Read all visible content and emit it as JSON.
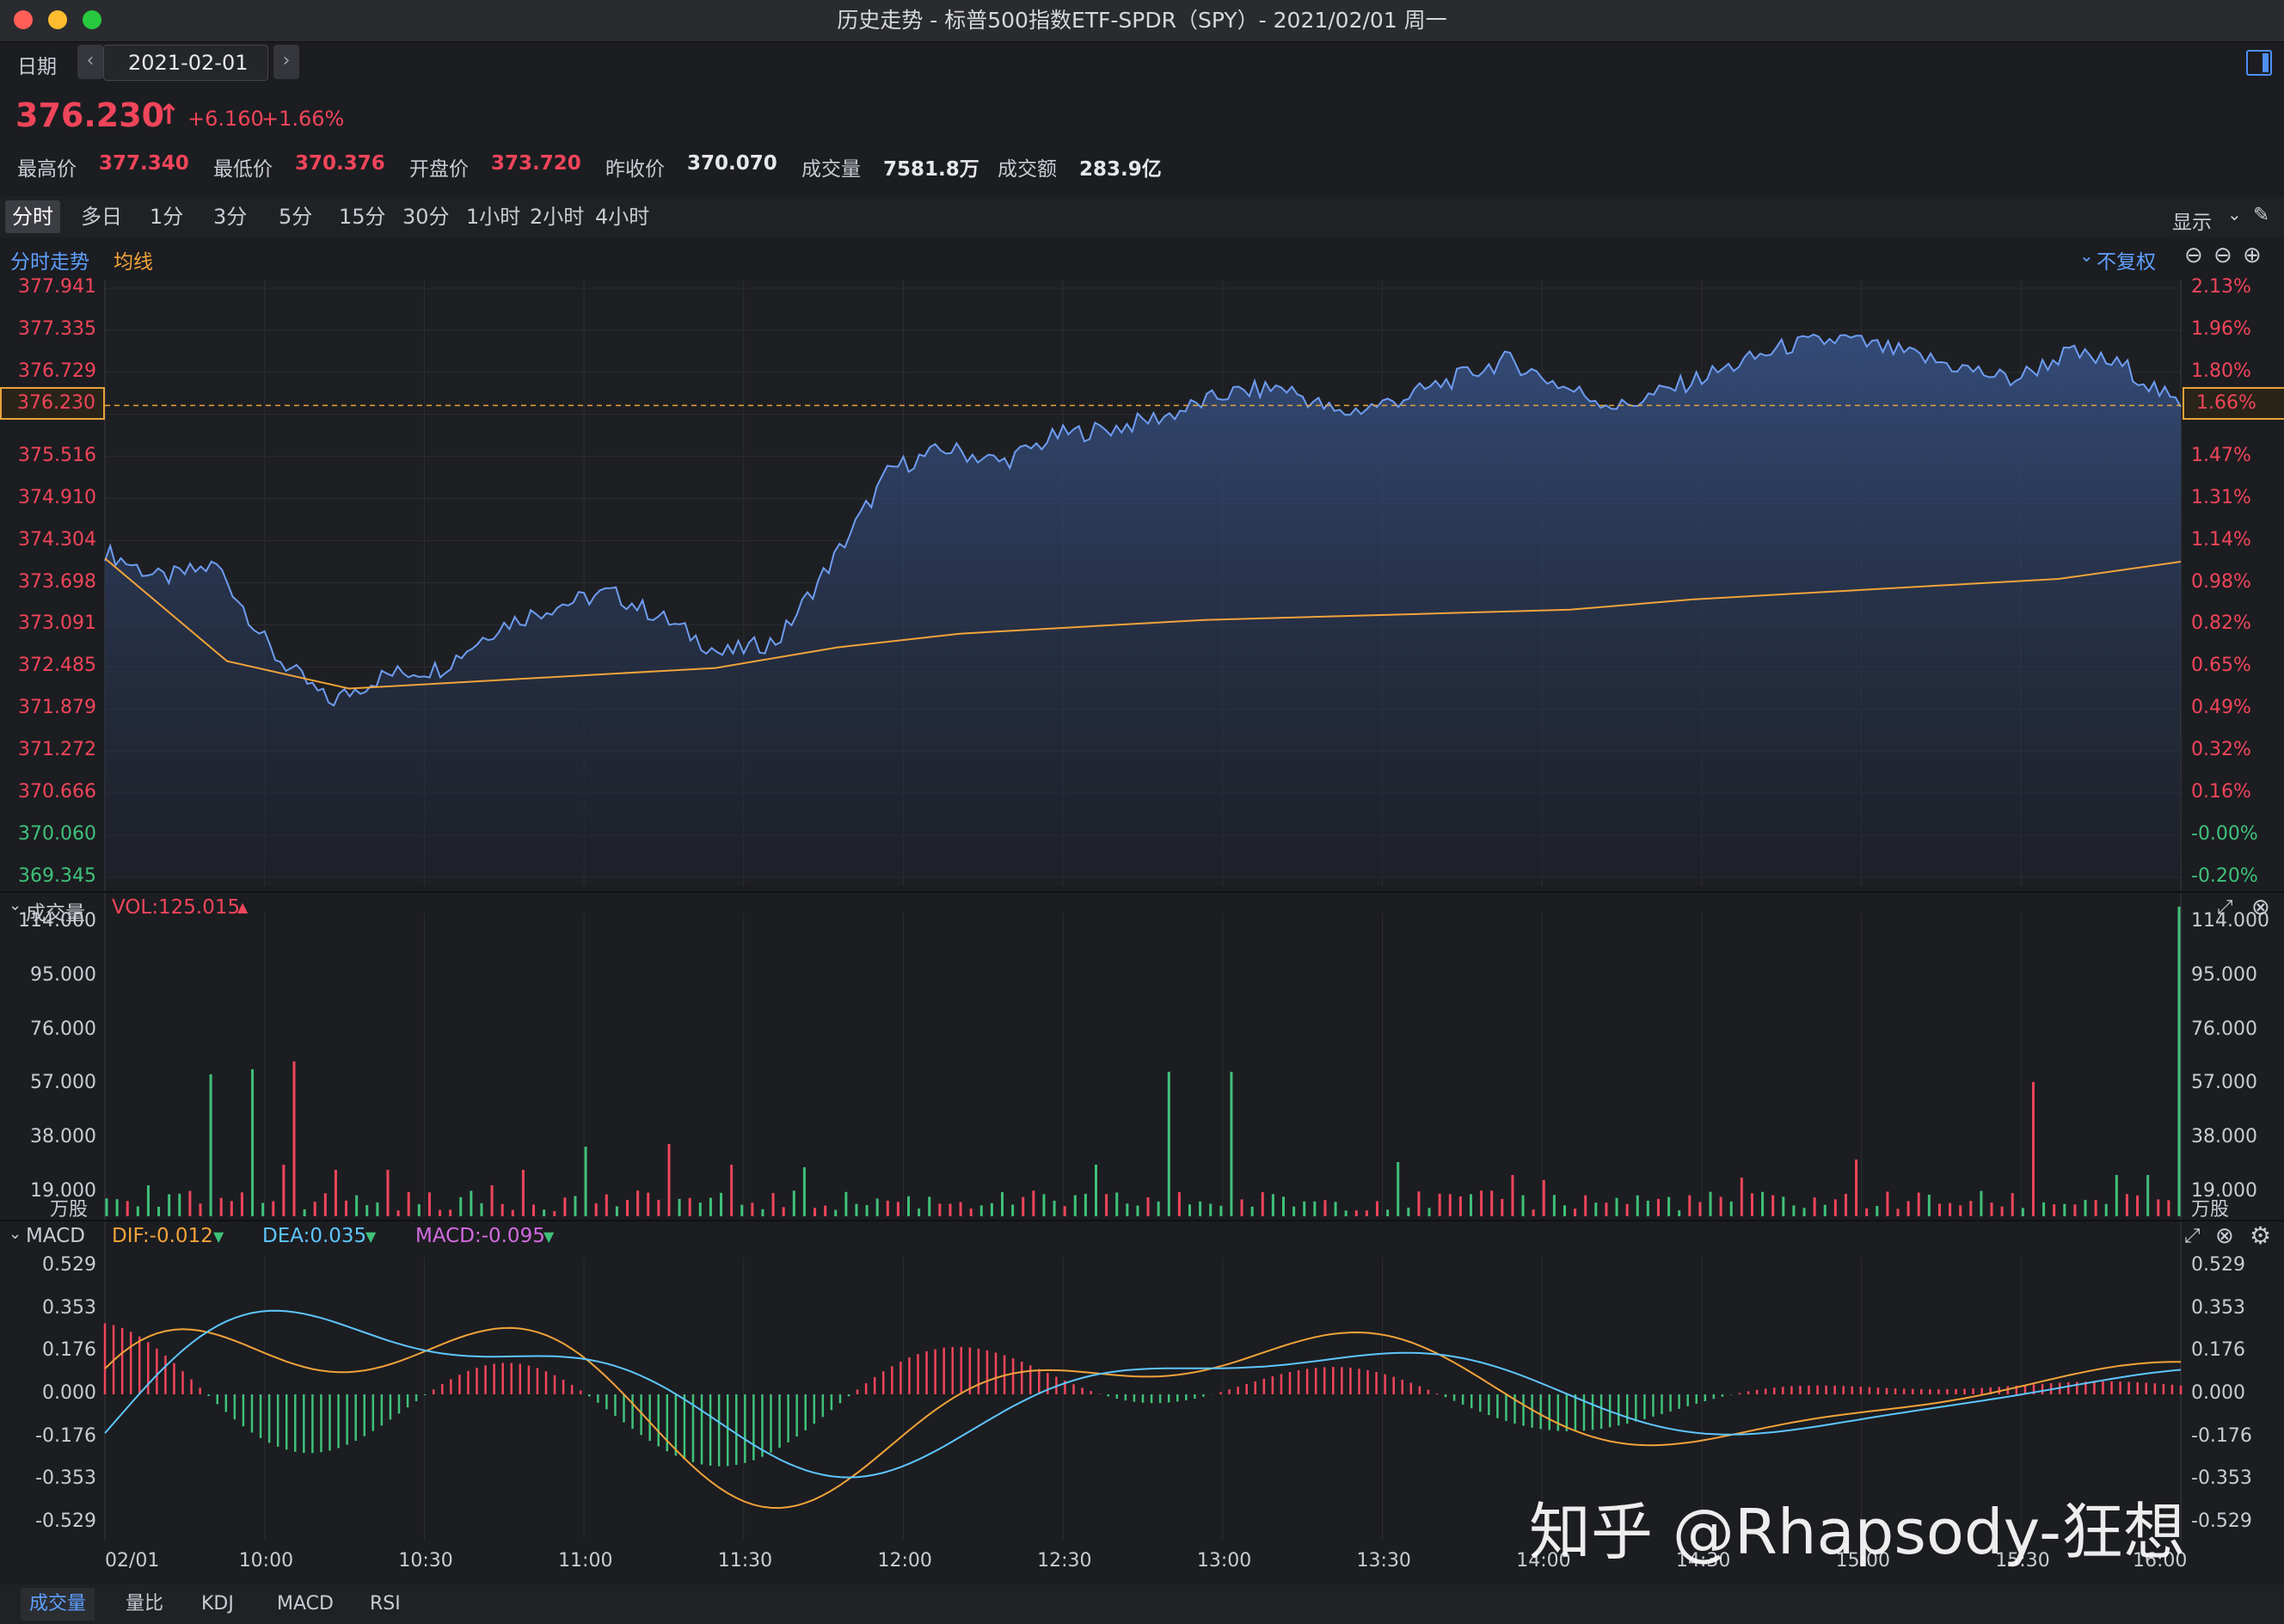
{
  "window": {
    "title": "历史走势 - 标普500指数ETF-SPDR（SPY）- 2021/02/01 周一"
  },
  "toolbar": {
    "date_label": "日期",
    "date_value": "2021-02-01",
    "prev_icon": "chevron-left-icon",
    "next_icon": "chevron-right-icon",
    "panel_icon": "sidebar-toggle-icon"
  },
  "quote": {
    "price": "376.230",
    "change": "+6.160",
    "change_pct": "+1.66%",
    "high_label": "最高价",
    "high": "377.340",
    "low_label": "最低价",
    "low": "370.376",
    "open_label": "开盘价",
    "open": "373.720",
    "prev_close_label": "昨收价",
    "prev_close": "370.070",
    "volume_label": "成交量",
    "volume": "7581.8万",
    "amount_label": "成交额",
    "amount": "283.9亿"
  },
  "period_tabs": [
    "分时",
    "多日",
    "1分",
    "3分",
    "5分",
    "15分",
    "30分",
    "1小时",
    "2小时",
    "4小时"
  ],
  "active_period": "分时",
  "display_menu": "显示",
  "price_panel": {
    "legend_price": "分时走势",
    "legend_avg": "均线",
    "adjust": "不复权",
    "left_ticks": [
      "377.941",
      "377.335",
      "376.729",
      "376.230",
      "375.516",
      "374.910",
      "374.304",
      "373.698",
      "373.091",
      "372.485",
      "371.879",
      "371.272",
      "370.666",
      "370.060",
      "369.345"
    ],
    "right_ticks": [
      "2.13%",
      "1.96%",
      "1.80%",
      "1.66%",
      "1.47%",
      "1.31%",
      "1.14%",
      "0.98%",
      "0.82%",
      "0.65%",
      "0.49%",
      "0.32%",
      "0.16%",
      "-0.00%",
      "-0.20%"
    ],
    "current_price_marker": "376.230",
    "current_pct_marker": "1.66%"
  },
  "volume_panel": {
    "title": "成交量",
    "vol_label": "VOL:125.015",
    "ticks": [
      "114.000",
      "95.000",
      "76.000",
      "57.000",
      "38.000",
      "19.000"
    ],
    "unit": "万股"
  },
  "macd_panel": {
    "title": "MACD",
    "dif": "DIF:-0.012",
    "dea": "DEA:0.035",
    "macd": "MACD:-0.095",
    "ticks": [
      "0.529",
      "0.353",
      "0.176",
      "0.000",
      "-0.176",
      "-0.353",
      "-0.529"
    ]
  },
  "time_axis": [
    "02/01",
    "10:00",
    "10:30",
    "11:00",
    "11:30",
    "12:00",
    "12:30",
    "13:00",
    "13:30",
    "14:00",
    "14:30",
    "15:00",
    "15:30",
    "16:00"
  ],
  "bottom_tabs": [
    "成交量",
    "量比",
    "KDJ",
    "MACD",
    "RSI"
  ],
  "active_bottom_tab": "成交量",
  "watermark": "知乎 @Rhapsody-狂想",
  "colors": {
    "up": "#f0455a",
    "down": "#3fc17a",
    "price_line": "#6e9cf0",
    "avg_line": "#f2a33a",
    "dea_line": "#5ec6ff",
    "macd_text": "#d36be0"
  },
  "chart_data": {
    "type": "line",
    "x_range": [
      "09:30",
      "16:00"
    ],
    "ylim": [
      369.345,
      377.941
    ],
    "prev_close": 370.07,
    "series": [
      {
        "name": "分时走势",
        "values": [
          374.1,
          373.7,
          373.9,
          372.6,
          371.9,
          372.3,
          372.4,
          373.0,
          373.3,
          373.5,
          373.1,
          372.6,
          372.8,
          374.0,
          375.3,
          375.6,
          375.4,
          375.8,
          375.9,
          376.1,
          376.4,
          376.5,
          376.1,
          376.3,
          376.6,
          376.9,
          376.5,
          376.2,
          376.5,
          376.8,
          377.1,
          377.2,
          377.0,
          376.8,
          376.6,
          377.0,
          376.8,
          376.2
        ]
      },
      {
        "name": "均线",
        "values": [
          374.0,
          372.5,
          372.1,
          372.2,
          372.3,
          372.4,
          372.7,
          372.9,
          373.0,
          373.1,
          373.15,
          373.2,
          373.25,
          373.4,
          373.5,
          373.6,
          373.7,
          373.95
        ]
      }
    ]
  }
}
